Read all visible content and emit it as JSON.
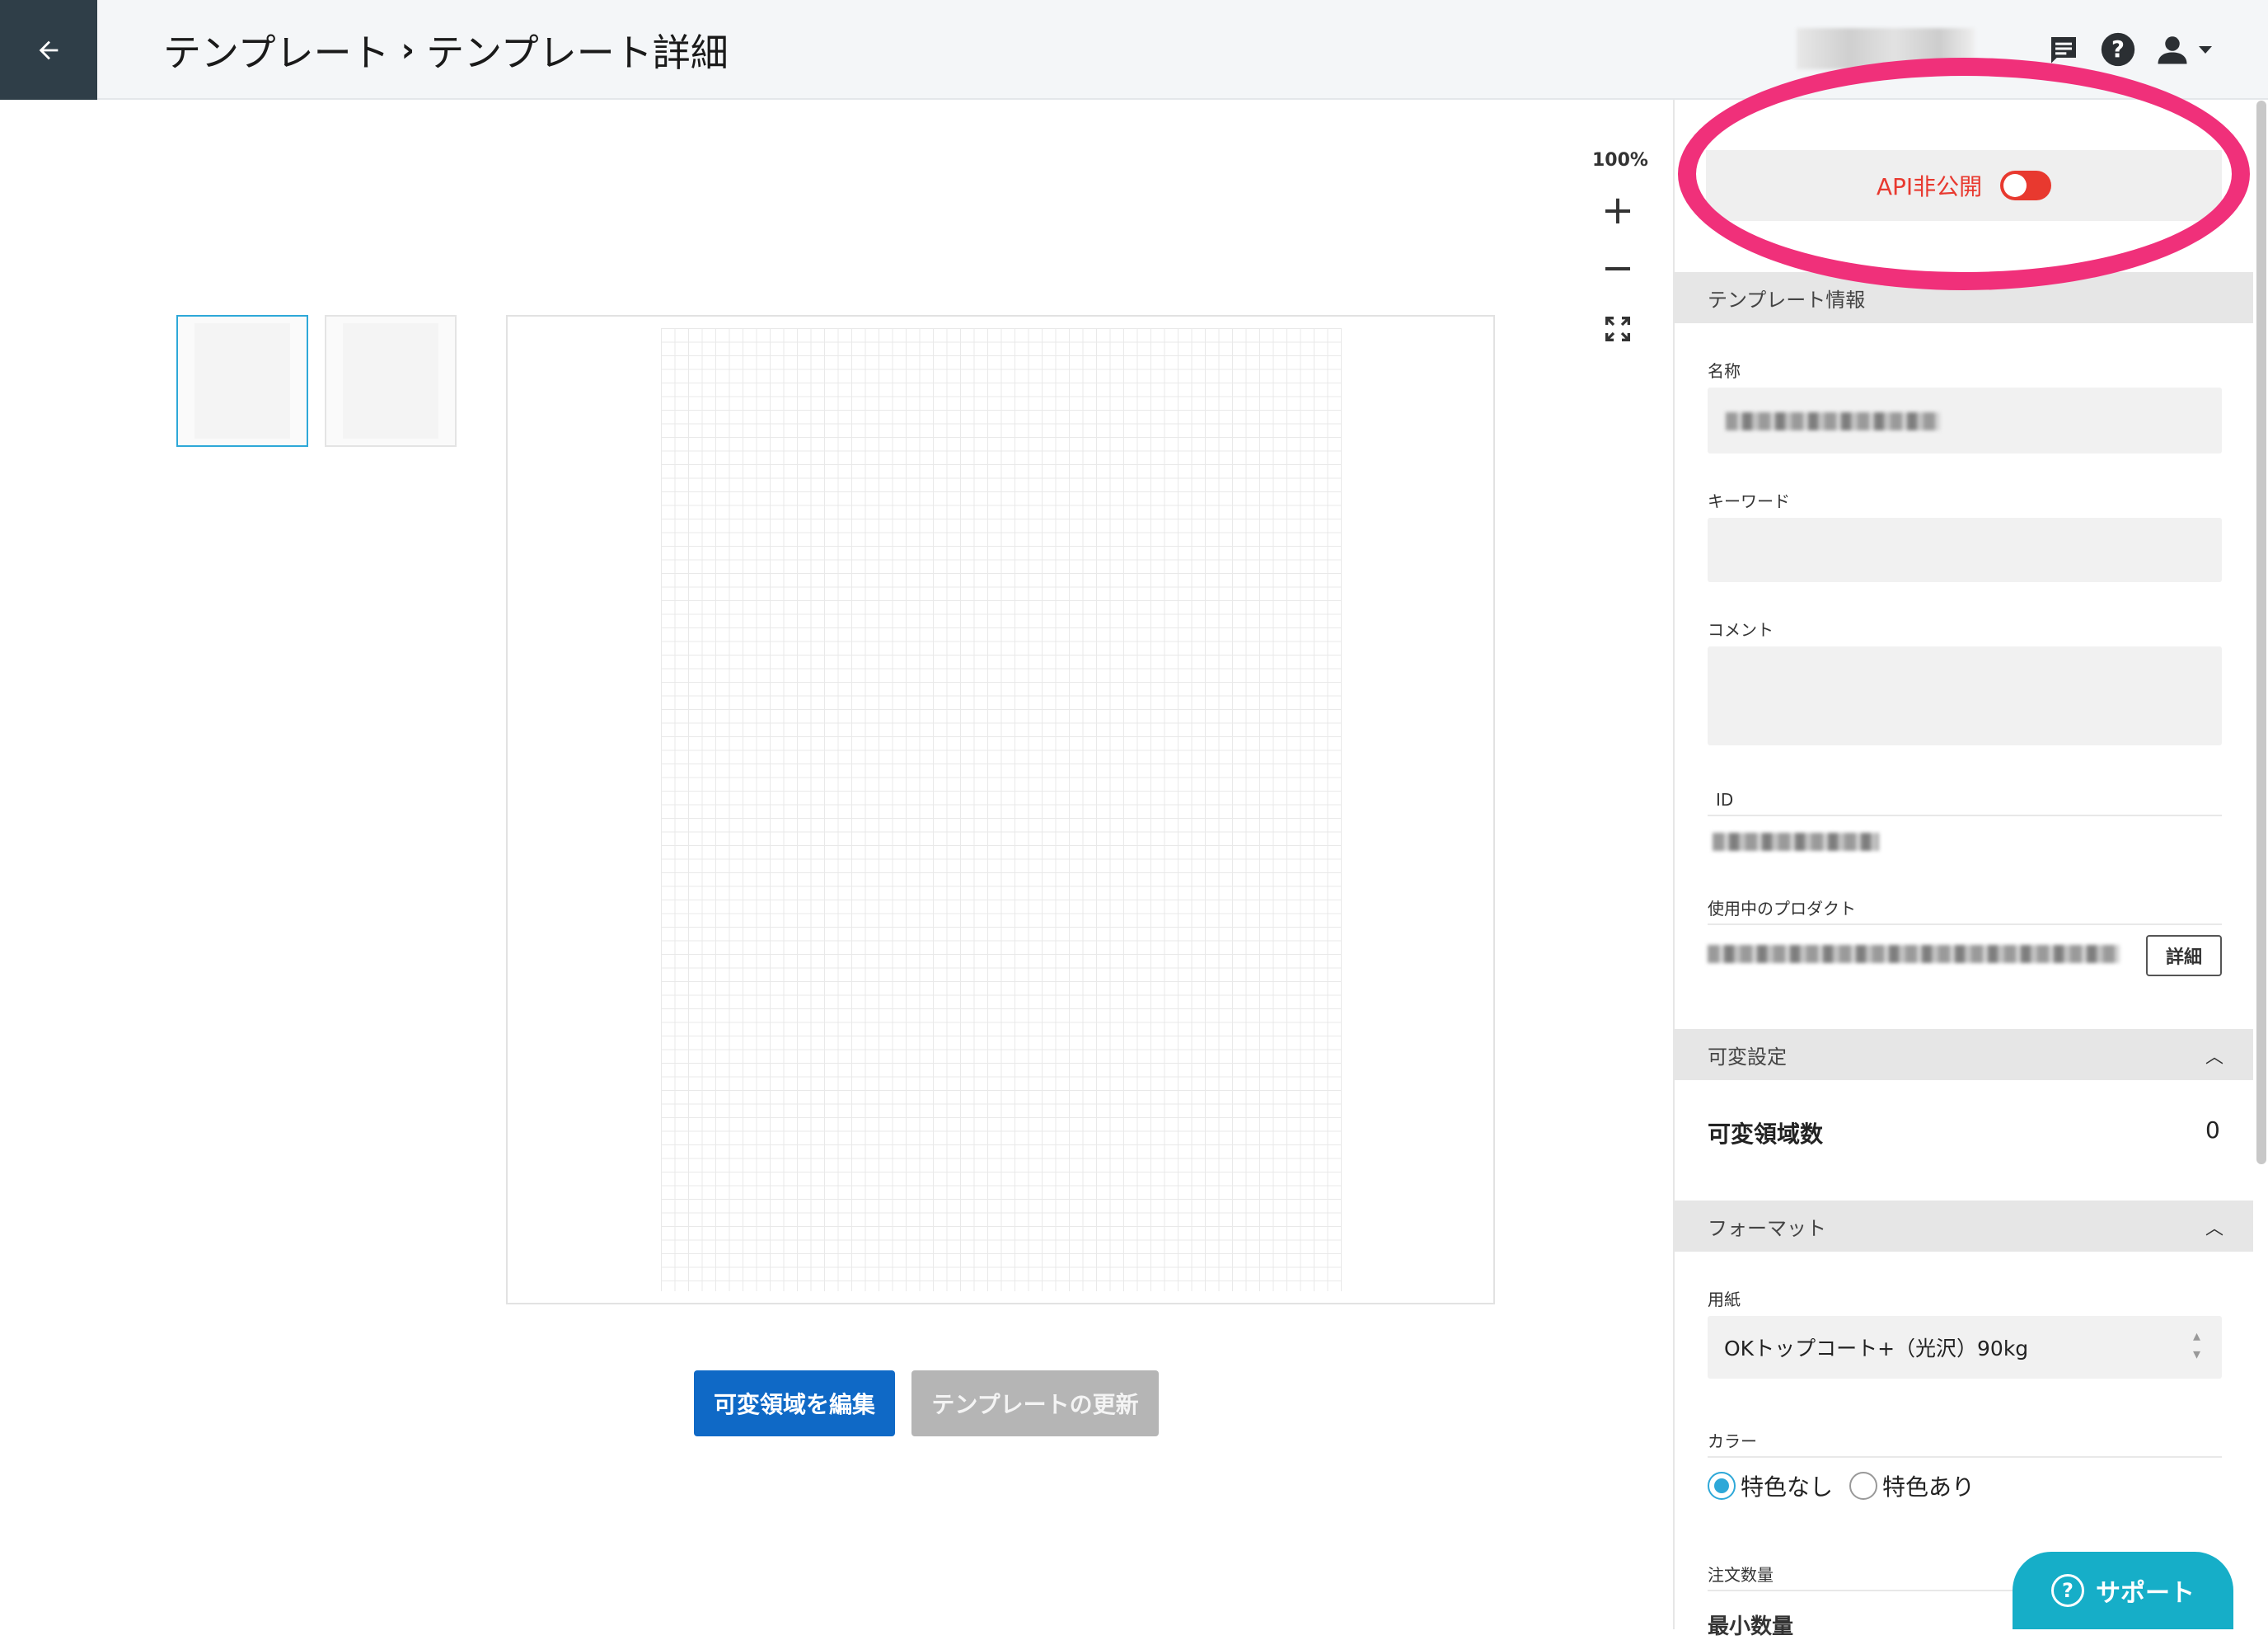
{
  "header": {
    "breadcrumb_parent": "テンプレート",
    "breadcrumb_separator": "›",
    "breadcrumb_current": "テンプレート詳細",
    "icons": [
      "arrow-left-icon",
      "chat-icon",
      "help-icon",
      "user-icon",
      "caret-down-icon"
    ]
  },
  "canvas": {
    "zoom_level": "100%",
    "zoom_in": "+",
    "zoom_out": "−",
    "edit_button": "可変領域を編集",
    "update_button": "テンプレートの更新"
  },
  "panel": {
    "api_toggle_label": "API非公開",
    "template_info_header": "テンプレート情報",
    "name_label": "名称",
    "keyword_label": "キーワード",
    "keyword_value": "",
    "comment_label": "コメント",
    "comment_value": "",
    "id_label": "ID",
    "product_label": "使用中のプロダクト",
    "detail_button": "詳細",
    "variable_section": "可変設定",
    "variable_count_label": "可変領域数",
    "variable_count_value": "0",
    "format_section": "フォーマット",
    "paper_label": "用紙",
    "paper_value": "OKトップコート+（光沢）90kg",
    "color_label": "カラー",
    "color_option_none": "特色なし",
    "color_option_yes": "特色あり",
    "order_qty_label": "注文数量",
    "min_qty_label": "最小数量"
  },
  "support_button": "サポート",
  "colors": {
    "header_bg": "#f4f6f8",
    "back_button_bg": "#2f3e48",
    "primary": "#0f69c6",
    "toggle_red": "#e8392f",
    "highlight_ellipse": "#f0307a",
    "support_bg": "#16aec8",
    "radio_accent": "#2ea8d8"
  }
}
